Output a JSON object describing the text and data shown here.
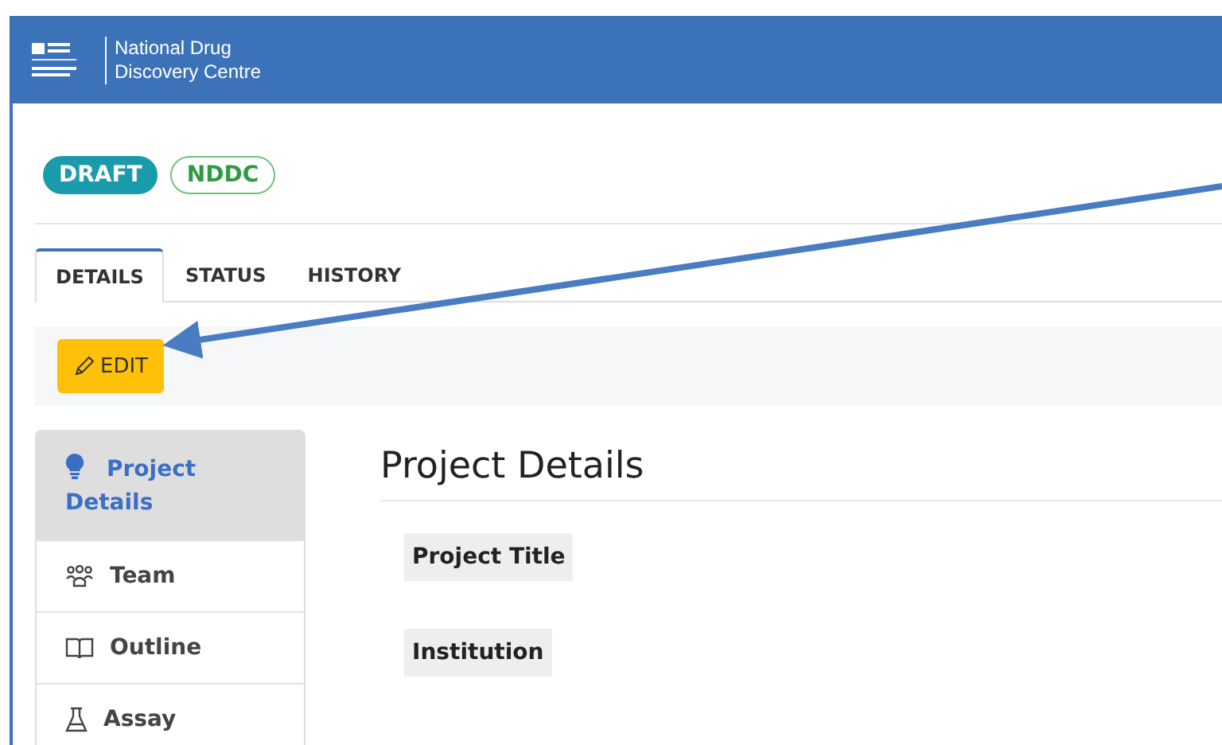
{
  "header": {
    "title_line_1": "National Drug",
    "title_line_2": "Discovery Centre"
  },
  "badges": [
    {
      "label": "DRAFT",
      "kind": "filled"
    },
    {
      "label": "NDDC",
      "kind": "outline"
    }
  ],
  "tabs": [
    {
      "label": "DETAILS",
      "selected": true
    },
    {
      "label": "STATUS",
      "selected": false
    },
    {
      "label": "HISTORY",
      "selected": false
    }
  ],
  "toolbar": {
    "edit_button": "EDIT"
  },
  "sidebar": {
    "items": [
      {
        "label": "Project Details",
        "kind": "bulb",
        "selected": true
      },
      {
        "label": "Team",
        "kind": "people",
        "selected": false
      },
      {
        "label": "Outline",
        "kind": "book",
        "selected": false
      },
      {
        "label": "Assay",
        "kind": "flask",
        "selected": false
      }
    ]
  },
  "main": {
    "heading": "Project Details",
    "fields": [
      {
        "label": "Project Title"
      },
      {
        "label": "Institution"
      }
    ]
  }
}
